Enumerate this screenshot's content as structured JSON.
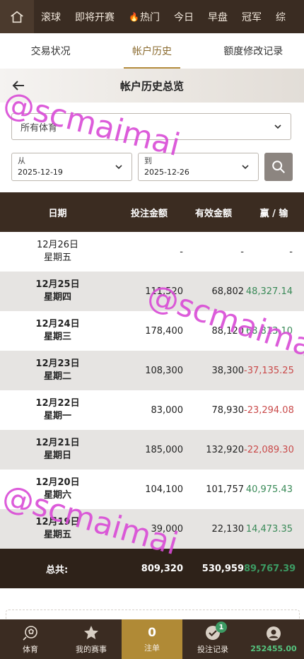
{
  "top_nav": {
    "items": [
      {
        "label": "滚球"
      },
      {
        "label": "即将开赛"
      },
      {
        "label": "热门"
      },
      {
        "label": "今日"
      },
      {
        "label": "早盘"
      },
      {
        "label": "冠军"
      },
      {
        "label": "综"
      }
    ]
  },
  "tabs": [
    {
      "label": "交易状况"
    },
    {
      "label": "帐户历史",
      "active": true
    },
    {
      "label": "额度修改记录"
    }
  ],
  "page": {
    "title": "帐户历史总览"
  },
  "filters": {
    "sport": "所有体育",
    "from_label": "从",
    "from_value": "2025-12-19",
    "to_label": "到",
    "to_value": "2025-12-26"
  },
  "table": {
    "headers": [
      "日期",
      "投注金额",
      "有效金额",
      "赢 / 输"
    ],
    "rows": [
      {
        "date": "12月26日",
        "weekday": "星期五",
        "bet": "-",
        "valid": "-",
        "winloss": "-",
        "sign": "none"
      },
      {
        "date": "12月25日",
        "weekday": "星期四",
        "bet": "111,520",
        "valid": "68,802",
        "winloss": "48,327.14",
        "sign": "pos"
      },
      {
        "date": "12月24日",
        "weekday": "星期三",
        "bet": "178,400",
        "valid": "88,120",
        "winloss": "68,813.10",
        "sign": "pos"
      },
      {
        "date": "12月23日",
        "weekday": "星期二",
        "bet": "108,300",
        "valid": "38,300",
        "winloss": "-37,135.25",
        "sign": "neg"
      },
      {
        "date": "12月22日",
        "weekday": "星期一",
        "bet": "83,000",
        "valid": "78,930",
        "winloss": "-23,294.08",
        "sign": "neg"
      },
      {
        "date": "12月21日",
        "weekday": "星期日",
        "bet": "185,000",
        "valid": "132,920",
        "winloss": "-22,089.30",
        "sign": "neg"
      },
      {
        "date": "12月20日",
        "weekday": "星期六",
        "bet": "104,100",
        "valid": "101,757",
        "winloss": "40,975.43",
        "sign": "pos"
      },
      {
        "date": "12月19日",
        "weekday": "星期五",
        "bet": "39,000",
        "valid": "22,130",
        "winloss": "14,473.35",
        "sign": "pos"
      }
    ],
    "total": {
      "label": "总共:",
      "bet": "809,320",
      "valid": "530,959",
      "winloss": "89,767.39"
    }
  },
  "bottom_nav": {
    "sports_label": "体育",
    "my_events_label": "我的赛事",
    "slip_count": "0",
    "slip_label": "注单",
    "bet_records_label": "投注记录",
    "bet_records_badge": "1",
    "balance": "252455.00"
  },
  "watermark": "@scmaimai",
  "colors": {
    "nav_bg": "#3a2c22",
    "accent": "#b08a36",
    "positive": "#3a8a58",
    "negative": "#c94a4a"
  }
}
